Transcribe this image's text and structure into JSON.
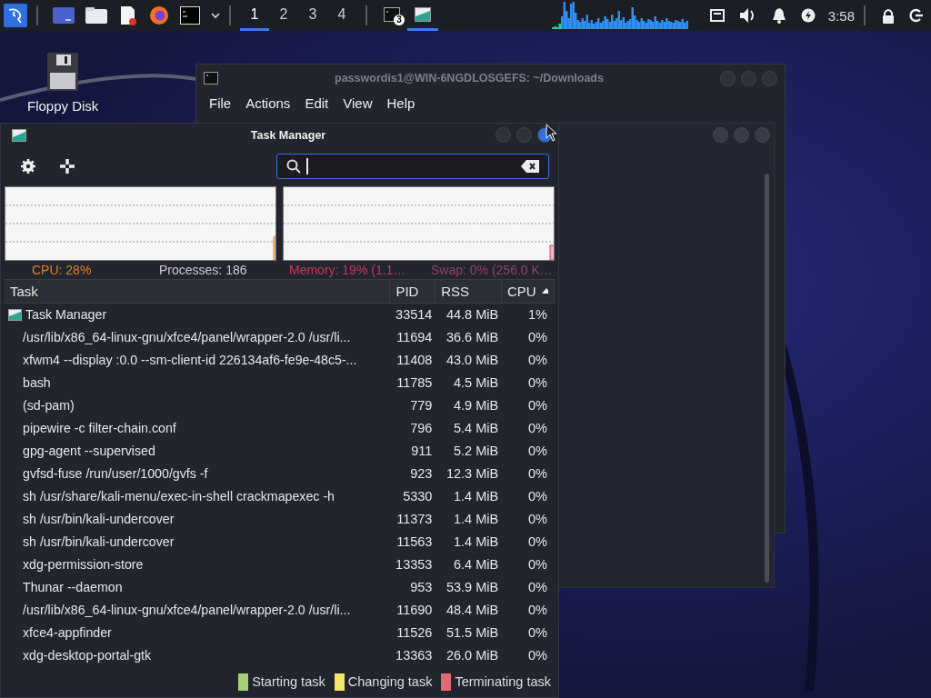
{
  "panel": {
    "workspaces": [
      {
        "label": "1",
        "selected": true
      },
      {
        "label": "2",
        "selected": false
      },
      {
        "label": "3",
        "selected": false
      },
      {
        "label": "4",
        "selected": false
      }
    ],
    "tasks": [
      {
        "kind": "terminal",
        "badge": "3",
        "selected": false
      },
      {
        "kind": "taskmanager",
        "selected": true
      }
    ],
    "clock": "3:58"
  },
  "desktop_icons": [
    {
      "label": "Floppy Disk"
    }
  ],
  "terminal": {
    "title": "passwordis1@WIN-6NGDLOSGEFS: ~/Downloads",
    "menu": [
      "File",
      "Actions",
      "Edit",
      "View",
      "Help"
    ]
  },
  "task_manager": {
    "title": "Task Manager",
    "status": {
      "cpu": "CPU: 28%",
      "processes": "Processes: 186",
      "memory": "Memory: 19% (1.1…",
      "swap": "Swap: 0% (256.0 K…"
    },
    "columns": [
      {
        "label": "Task",
        "sorted": false
      },
      {
        "label": "PID",
        "sorted": false
      },
      {
        "label": "RSS",
        "sorted": false
      },
      {
        "label": "CPU",
        "sorted": true
      }
    ],
    "rows": [
      {
        "kind": "app",
        "task": "Task Manager",
        "pid": "33514",
        "rss": "44.8 MiB",
        "cpu": "1%"
      },
      {
        "kind": "process",
        "task": "/usr/lib/x86_64-linux-gnu/xfce4/panel/wrapper-2.0 /usr/li...",
        "pid": "11694",
        "rss": "36.6 MiB",
        "cpu": "0%"
      },
      {
        "kind": "process",
        "task": "xfwm4 --display :0.0 --sm-client-id 226134af6-fe9e-48c5-...",
        "pid": "11408",
        "rss": "43.0 MiB",
        "cpu": "0%"
      },
      {
        "kind": "process",
        "task": "bash",
        "pid": "11785",
        "rss": "4.5 MiB",
        "cpu": "0%"
      },
      {
        "kind": "process",
        "task": "(sd-pam)",
        "pid": "779",
        "rss": "4.9 MiB",
        "cpu": "0%"
      },
      {
        "kind": "process",
        "task": "pipewire -c filter-chain.conf",
        "pid": "796",
        "rss": "5.4 MiB",
        "cpu": "0%"
      },
      {
        "kind": "process",
        "task": "gpg-agent --supervised",
        "pid": "911",
        "rss": "5.2 MiB",
        "cpu": "0%"
      },
      {
        "kind": "process",
        "task": "gvfsd-fuse /run/user/1000/gvfs -f",
        "pid": "923",
        "rss": "12.3 MiB",
        "cpu": "0%"
      },
      {
        "kind": "process",
        "task": "sh /usr/share/kali-menu/exec-in-shell crackmapexec -h",
        "pid": "5330",
        "rss": "1.4 MiB",
        "cpu": "0%"
      },
      {
        "kind": "process",
        "task": "sh /usr/bin/kali-undercover",
        "pid": "11373",
        "rss": "1.4 MiB",
        "cpu": "0%"
      },
      {
        "kind": "process",
        "task": "sh /usr/bin/kali-undercover",
        "pid": "11563",
        "rss": "1.4 MiB",
        "cpu": "0%"
      },
      {
        "kind": "process",
        "task": "xdg-permission-store",
        "pid": "13353",
        "rss": "6.4 MiB",
        "cpu": "0%"
      },
      {
        "kind": "process",
        "task": "Thunar --daemon",
        "pid": "953",
        "rss": "53.9 MiB",
        "cpu": "0%"
      },
      {
        "kind": "process",
        "task": "/usr/lib/x86_64-linux-gnu/xfce4/panel/wrapper-2.0 /usr/li...",
        "pid": "11690",
        "rss": "48.4 MiB",
        "cpu": "0%"
      },
      {
        "kind": "process",
        "task": "xfce4-appfinder",
        "pid": "11526",
        "rss": "51.5 MiB",
        "cpu": "0%"
      },
      {
        "kind": "process",
        "task": "xdg-desktop-portal-gtk",
        "pid": "13363",
        "rss": "26.0 MiB",
        "cpu": "0%"
      }
    ],
    "legend": [
      {
        "label": "Starting task",
        "color": "#a6cf7a"
      },
      {
        "label": "Changing task",
        "color": "#f2e56b"
      },
      {
        "label": "Terminating task",
        "color": "#e06b74"
      }
    ]
  }
}
